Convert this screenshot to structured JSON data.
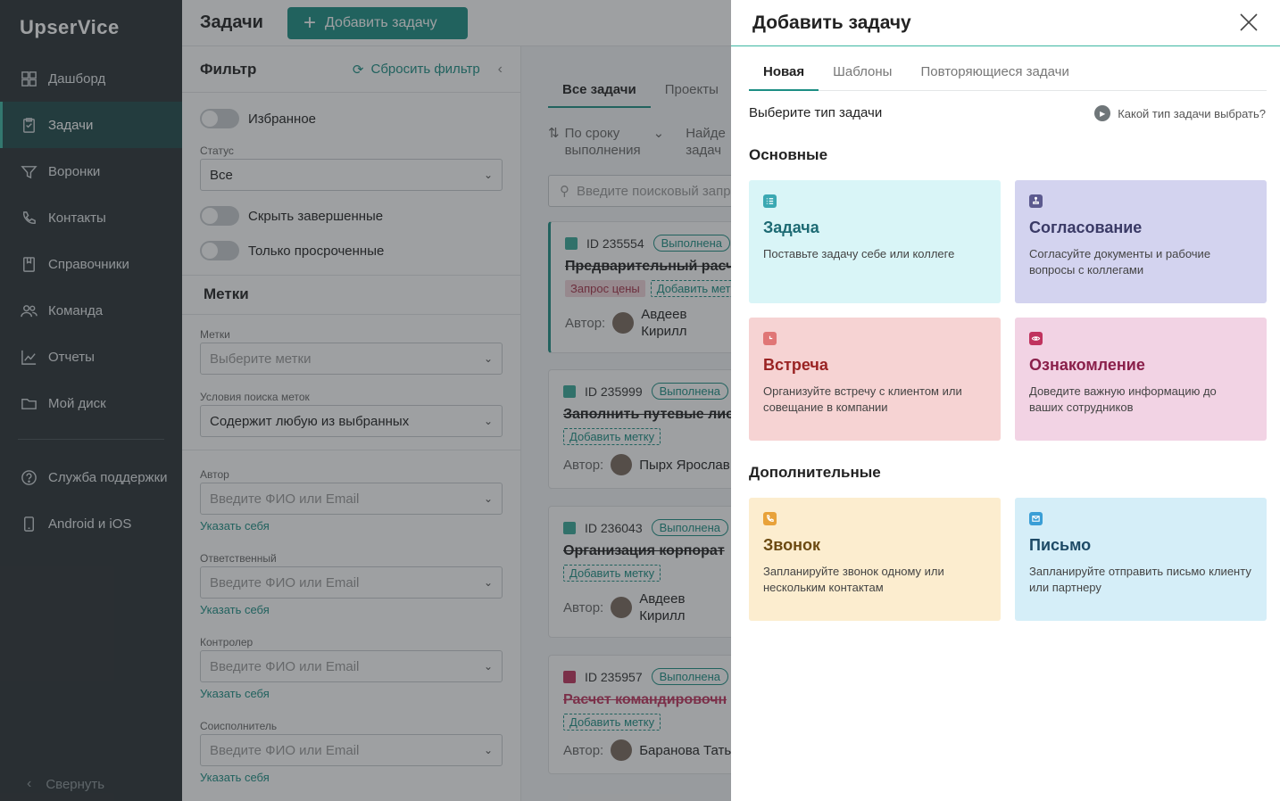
{
  "sidebar": {
    "logo": "UpserVice",
    "items": [
      {
        "label": "Дашборд",
        "icon": "dashboard-icon"
      },
      {
        "label": "Задачи",
        "icon": "tasks-icon"
      },
      {
        "label": "Воронки",
        "icon": "funnel-icon"
      },
      {
        "label": "Контакты",
        "icon": "phone-contacts-icon"
      },
      {
        "label": "Справочники",
        "icon": "book-icon"
      },
      {
        "label": "Команда",
        "icon": "team-icon"
      },
      {
        "label": "Отчеты",
        "icon": "chart-icon"
      },
      {
        "label": "Мой диск",
        "icon": "folder-icon"
      }
    ],
    "secondary": [
      {
        "label": "Служба поддержки",
        "icon": "help-icon"
      },
      {
        "label": "Android и iOS",
        "icon": "mobile-icon"
      }
    ],
    "collapse_label": "Свернуть"
  },
  "header": {
    "title": "Задачи",
    "add_task_label": "Добавить задачу"
  },
  "filter": {
    "title": "Фильтр",
    "reset_label": "Сбросить фильтр",
    "favorites_label": "Избранное",
    "status_label": "Статус",
    "status_value": "Все",
    "hide_completed_label": "Скрыть завершенные",
    "only_overdue_label": "Только просроченные",
    "tags_section": "Метки",
    "tags_label": "Метки",
    "tags_placeholder": "Выберите метки",
    "tag_condition_label": "Условия поиска меток",
    "tag_condition_value": "Содержит любую из выбранных",
    "author_label": "Автор",
    "responsible_label": "Ответственный",
    "controller_label": "Контролер",
    "coexecutor_label": "Соисполнитель",
    "person_placeholder": "Введите ФИО или Email",
    "self_link": "Указать себя"
  },
  "list": {
    "tabs": [
      "Все задачи",
      "Проекты"
    ],
    "sort_label_1": "По сроку",
    "sort_label_2": "выполнения",
    "find_label_1": "Найде",
    "find_label_2": "задач",
    "search_placeholder": "Введите поисковый запр",
    "author_prefix": "Автор:",
    "add_tag_label": "Добавить метку",
    "cards": [
      {
        "id": "ID 235554",
        "status": "Выполнена",
        "name": "Предварительный расч",
        "tag": "Запрос цены",
        "author_1": "Авдеев",
        "author_2": "Кирилл",
        "color": "#3aa99a"
      },
      {
        "id": "ID 235999",
        "status": "Выполнена",
        "name": "Заполнить путевые лис",
        "author_1": "Пырх Ярослав",
        "author_2": "",
        "color": "#3aa99a"
      },
      {
        "id": "ID 236043",
        "status": "Выполнена",
        "name": "Организация корпорат",
        "author_1": "Авдеев",
        "author_2": "Кирилл",
        "color": "#3aa99a"
      },
      {
        "id": "ID 235957",
        "status": "Выполнена",
        "name": "Расчет командировочн",
        "author_1": "Баранова Татья",
        "author_2": "",
        "color": "#c0335e"
      }
    ]
  },
  "drawer": {
    "title": "Добавить задачу",
    "tabs": [
      "Новая",
      "Шаблоны",
      "Повторяющиеся задачи"
    ],
    "choose_label": "Выберите тип задачи",
    "help_label": "Какой тип задачи выбрать?",
    "main_group": "Основные",
    "extra_group": "Дополнительные",
    "types": [
      {
        "title": "Задача",
        "desc": "Поставьте задачу себе или коллеге",
        "icon": "task-list-icon",
        "bg": "#d9f5f7",
        "accent": "#1f8a93",
        "title_color": "#1d6a73"
      },
      {
        "title": "Согласование",
        "desc": "Согласуйте документы и рабочие вопросы с коллегами",
        "icon": "stamp-icon",
        "bg": "#d3d3ef",
        "accent": "#5c5a8f",
        "title_color": "#3a3a66"
      },
      {
        "title": "Встреча",
        "desc": "Организуйте встречу с клиентом или совещание в компании",
        "icon": "clock-icon",
        "bg": "#f6d3d3",
        "accent": "#e07676",
        "title_color": "#9a2323"
      },
      {
        "title": "Ознакомление",
        "desc": "Доведите важную информацию до ваших сотрудников",
        "icon": "eye-icon",
        "bg": "#f2d3e4",
        "accent": "#c0335e",
        "title_color": "#8a1f4a"
      },
      {
        "title": "Звонок",
        "desc": "Запланируйте звонок одному или нескольким контактам",
        "icon": "phone-icon",
        "bg": "#fcedcf",
        "accent": "#e8a23a",
        "title_color": "#6b4a12"
      },
      {
        "title": "Письмо",
        "desc": "Запланируйте отправить письмо клиенту или партнеру",
        "icon": "mail-icon",
        "bg": "#d5eef8",
        "accent": "#3a9ed6",
        "title_color": "#1d4a66"
      }
    ]
  }
}
